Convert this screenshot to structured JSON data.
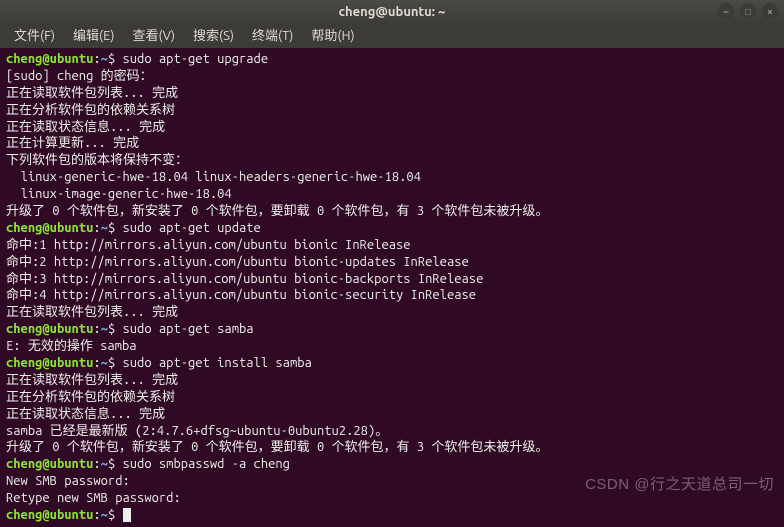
{
  "titlebar": {
    "title": "cheng@ubuntu: ~"
  },
  "menubar": {
    "items": [
      "文件(F)",
      "编辑(E)",
      "查看(V)",
      "搜索(S)",
      "终端(T)",
      "帮助(H)"
    ]
  },
  "prompt": {
    "user_host": "cheng@ubuntu",
    "colon": ":",
    "path": "~",
    "dollar": "$ "
  },
  "session": [
    {
      "type": "cmd",
      "text": "sudo apt-get upgrade"
    },
    {
      "type": "out",
      "text": "[sudo] cheng 的密码："
    },
    {
      "type": "out",
      "text": "正在读取软件包列表... 完成"
    },
    {
      "type": "out",
      "text": "正在分析软件包的依赖关系树"
    },
    {
      "type": "out",
      "text": "正在读取状态信息... 完成"
    },
    {
      "type": "out",
      "text": "正在计算更新... 完成"
    },
    {
      "type": "out",
      "text": "下列软件包的版本将保持不变："
    },
    {
      "type": "out",
      "text": "  linux-generic-hwe-18.04 linux-headers-generic-hwe-18.04"
    },
    {
      "type": "out",
      "text": "  linux-image-generic-hwe-18.04"
    },
    {
      "type": "out",
      "text": "升级了 0 个软件包，新安装了 0 个软件包，要卸载 0 个软件包，有 3 个软件包未被升级。"
    },
    {
      "type": "cmd",
      "text": "sudo apt-get update"
    },
    {
      "type": "out",
      "text": "命中:1 http://mirrors.aliyun.com/ubuntu bionic InRelease"
    },
    {
      "type": "out",
      "text": "命中:2 http://mirrors.aliyun.com/ubuntu bionic-updates InRelease"
    },
    {
      "type": "out",
      "text": "命中:3 http://mirrors.aliyun.com/ubuntu bionic-backports InRelease"
    },
    {
      "type": "out",
      "text": "命中:4 http://mirrors.aliyun.com/ubuntu bionic-security InRelease"
    },
    {
      "type": "out",
      "text": "正在读取软件包列表... 完成"
    },
    {
      "type": "cmd",
      "text": "sudo apt-get samba"
    },
    {
      "type": "out",
      "text": "E: 无效的操作 samba"
    },
    {
      "type": "cmd",
      "text": "sudo apt-get install samba"
    },
    {
      "type": "out",
      "text": "正在读取软件包列表... 完成"
    },
    {
      "type": "out",
      "text": "正在分析软件包的依赖关系树"
    },
    {
      "type": "out",
      "text": "正在读取状态信息... 完成"
    },
    {
      "type": "out",
      "text": "samba 已经是最新版 (2:4.7.6+dfsg~ubuntu-0ubuntu2.28)。"
    },
    {
      "type": "out",
      "text": "升级了 0 个软件包，新安装了 0 个软件包，要卸载 0 个软件包，有 3 个软件包未被升级。"
    },
    {
      "type": "cmd",
      "text": "sudo smbpasswd -a cheng"
    },
    {
      "type": "out",
      "text": "New SMB password:"
    },
    {
      "type": "out",
      "text": "Retype new SMB password:"
    },
    {
      "type": "cmd",
      "text": "",
      "cursor": true
    }
  ],
  "watermark": "CSDN @行之天道总司一切"
}
